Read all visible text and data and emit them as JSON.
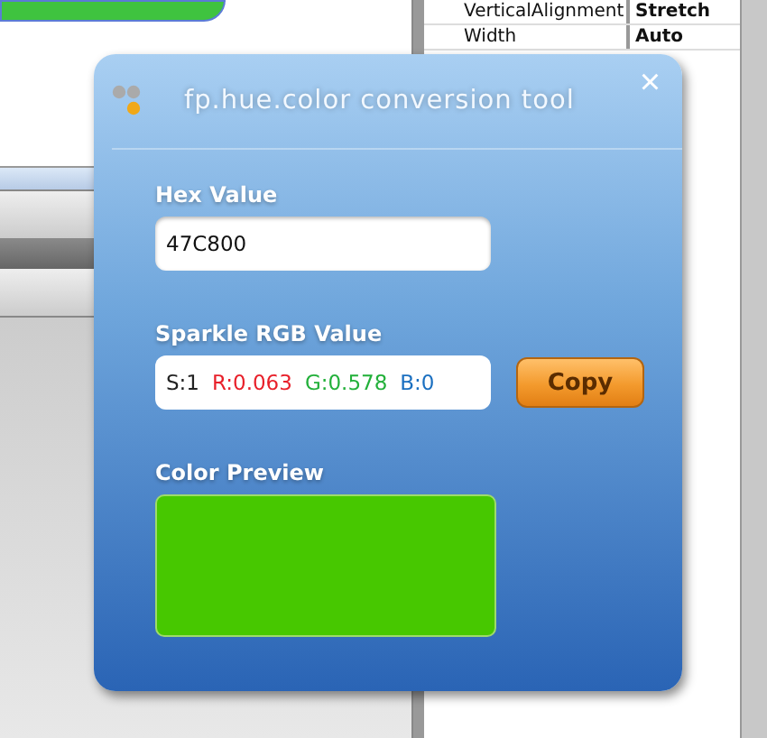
{
  "properties": [
    {
      "name": "VerticalAlignment",
      "value": "Stretch"
    },
    {
      "name": "Width",
      "value": "Auto"
    }
  ],
  "dialog": {
    "title": "fp.hue.color conversion tool",
    "close": "×",
    "hex": {
      "label": "Hex Value",
      "value": "47C800"
    },
    "rgb": {
      "label": "Sparkle RGB Value",
      "parts": [
        {
          "text": "S:1",
          "color": "#222222"
        },
        {
          "text": "R:0.063",
          "color": "#e8202a"
        },
        {
          "text": "G:0.578",
          "color": "#22b03a"
        },
        {
          "text": "B:0",
          "color": "#1a6fc0"
        }
      ]
    },
    "copy_button": "Copy",
    "preview": {
      "label": "Color Preview",
      "color": "#47c800"
    }
  }
}
